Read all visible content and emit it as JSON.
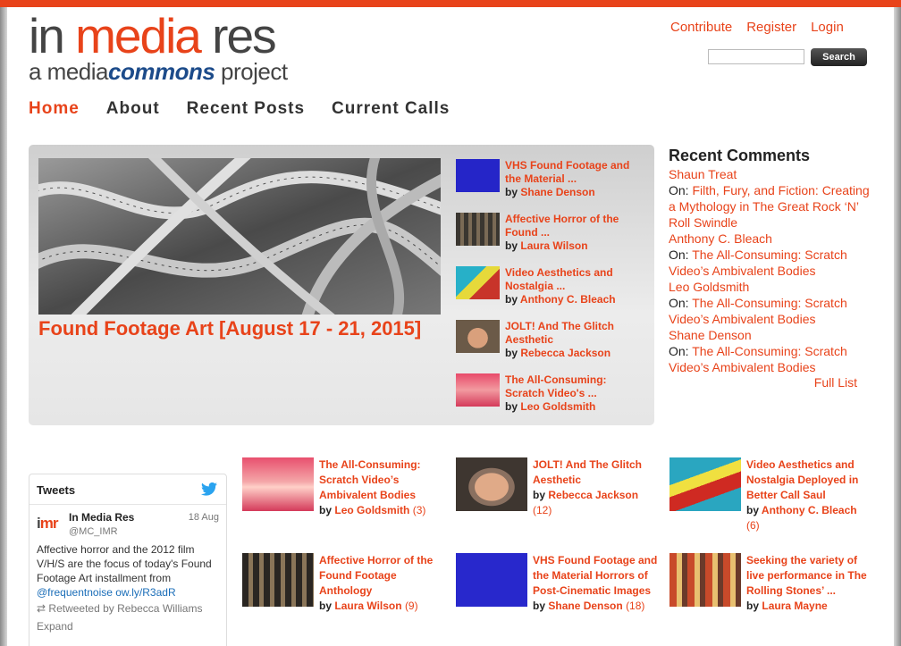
{
  "logo": {
    "line1_a": "in ",
    "line1_b": "media",
    "line1_c": " res",
    "line2_a": "a media",
    "line2_b": "commons",
    "line2_c": " project"
  },
  "user_links": [
    "Contribute",
    "Register",
    "Login"
  ],
  "search": {
    "button": "Search",
    "placeholder": ""
  },
  "nav": [
    {
      "label": "Home",
      "active": true
    },
    {
      "label": "About"
    },
    {
      "label": "Recent Posts"
    },
    {
      "label": "Current Calls"
    }
  ],
  "featured": {
    "title": "Found Footage Art [August 17 - 21, 2015]",
    "items": [
      {
        "title": "VHS Found Footage and the Material ...",
        "by": "by",
        "author": "Shane Denson",
        "thumb": "blue-screen"
      },
      {
        "title": "Affective Horror of the Found ...",
        "by": "by",
        "author": "Laura Wilson",
        "thumb": "dark-grid"
      },
      {
        "title": "Video Aesthetics and Nostalgia ...",
        "by": "by",
        "author": "Anthony C. Bleach",
        "thumb": "saul"
      },
      {
        "title": "JOLT! And The Glitch Aesthetic",
        "by": "by",
        "author": "Rebecca Jackson",
        "thumb": "face"
      },
      {
        "title": "The All-Consuming: Scratch Video's ...",
        "by": "by",
        "author": "Leo Goldsmith",
        "thumb": "pink"
      }
    ]
  },
  "recent_comments": {
    "heading": "Recent Comments",
    "items": [
      {
        "author": "Shaun Treat",
        "on": "On:",
        "post": "Filth, Fury, and Fiction: Creating a Mythology in The Great Rock ‘N’ Roll Swindle"
      },
      {
        "author": "Anthony C. Bleach",
        "on": "On:",
        "post": "The All-Consuming: Scratch Video’s Ambivalent Bodies"
      },
      {
        "author": "Leo Goldsmith",
        "on": "On:",
        "post": "The All-Consuming: Scratch Video’s Ambivalent Bodies"
      },
      {
        "author": "Shane Denson",
        "on": "On:",
        "post": "The All-Consuming: Scratch Video’s Ambivalent Bodies"
      }
    ],
    "full_list": "Full List"
  },
  "tweets": {
    "heading": "Tweets",
    "avatar_a": "i",
    "avatar_b": "mr",
    "name": "In Media Res",
    "handle": "@MC_IMR",
    "date": "18 Aug",
    "text": "Affective horror and the 2012 film V/H/S are the focus of today's Found Footage Art installment from",
    "mention": "@frequentnoise",
    "link": "ow.ly/R3adR",
    "retweet": "Retweeted by Rebecca Williams",
    "expand": "Expand"
  },
  "posts": [
    {
      "title": "The All-Consuming: Scratch Video’s Ambivalent Bodies",
      "by": "by",
      "author": "Leo Goldsmith",
      "count": "(3)",
      "thumb": "pink"
    },
    {
      "title": "JOLT! And The Glitch Aesthetic",
      "by": "by",
      "author": "Rebecca Jackson",
      "count": "(12)",
      "thumb": "face"
    },
    {
      "title": "Video Aesthetics and Nostalgia Deployed in Better Call Saul",
      "by": "by",
      "author": "Anthony C. Bleach",
      "count": "(6)",
      "thumb": "saul"
    },
    {
      "title": "Affective Horror of the Found Footage Anthology",
      "by": "by",
      "author": "Laura Wilson",
      "count": "(9)",
      "thumb": "dark-grid"
    },
    {
      "title": "VHS Found Footage and the Material Horrors of Post-Cinematic Images",
      "by": "by",
      "author": "Shane Denson",
      "count": "(18)",
      "thumb": "blue-screen"
    },
    {
      "title": "Seeking the variety of live performance in The Rolling Stones’ ...",
      "by": "by",
      "author": "Laura Mayne",
      "count": "",
      "thumb": "stones"
    }
  ],
  "colors": {
    "accent": "#e8431a",
    "dark": "#222222",
    "link_blue": "#1a6db8"
  }
}
